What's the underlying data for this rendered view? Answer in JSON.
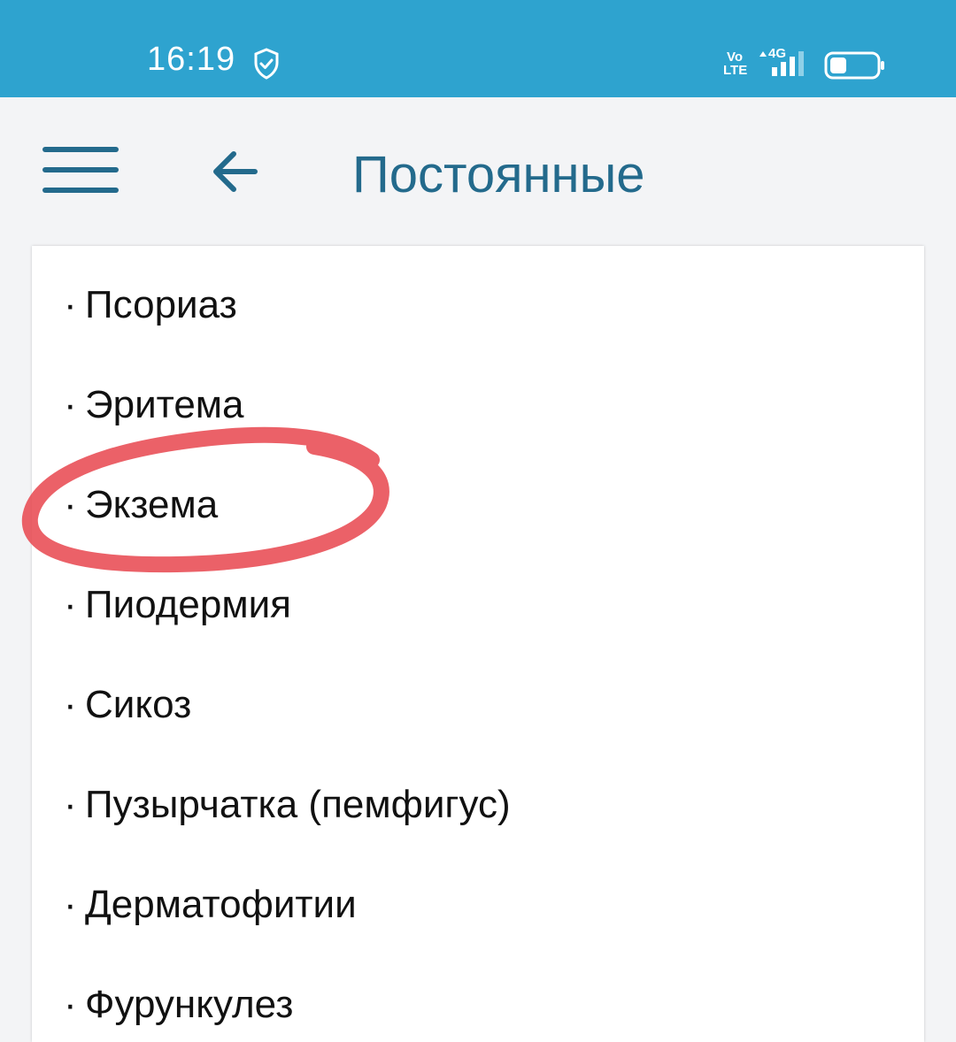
{
  "status_bar": {
    "time": "16:19",
    "network_top": "Vo",
    "network_bottom": "LTE",
    "network_type": "4G",
    "icons": [
      "shield-check-icon",
      "signal-icon",
      "battery-icon"
    ]
  },
  "app_bar": {
    "title": "Постоянные",
    "menu_icon": "hamburger-menu-icon",
    "back_icon": "arrow-left-icon"
  },
  "list": {
    "bullet": "·",
    "items": [
      {
        "label": "Псориаз"
      },
      {
        "label": "Эритема"
      },
      {
        "label": "Экзема"
      },
      {
        "label": "Пиодермия"
      },
      {
        "label": "Сикоз"
      },
      {
        "label": "Пузырчатка (пемфигус)"
      },
      {
        "label": "Дерматофитии"
      },
      {
        "label": "Фурункулез"
      }
    ]
  },
  "colors": {
    "status_bar": "#2ea3cf",
    "accent": "#236a8c",
    "annotation": "#e8454e"
  }
}
